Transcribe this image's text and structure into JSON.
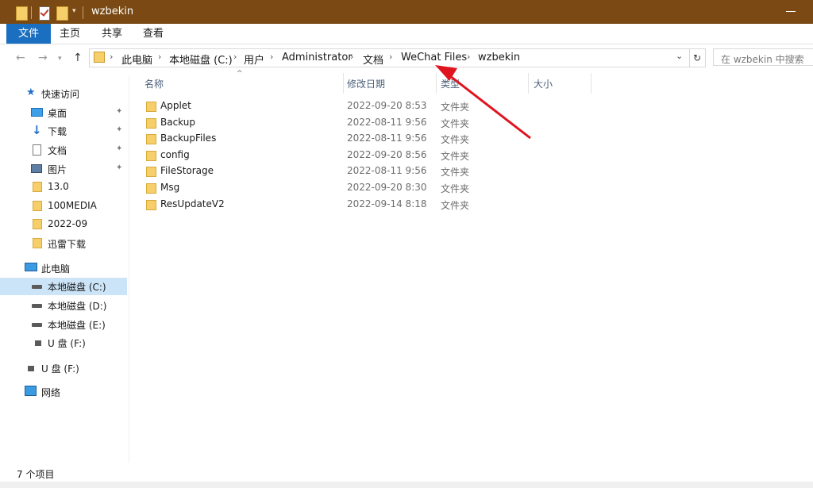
{
  "window": {
    "title": "wzbekin"
  },
  "ribbon": {
    "tabs": [
      "文件",
      "主页",
      "共享",
      "查看"
    ]
  },
  "address": {
    "crumbs": [
      "此电脑",
      "本地磁盘 (C:)",
      "用户",
      "Administrator",
      "文档",
      "WeChat Files",
      "wzbekin"
    ]
  },
  "search": {
    "placeholder": "在 wzbekin 中搜索"
  },
  "sidebar": {
    "quick_access": "快速访问",
    "items": [
      {
        "label": "桌面"
      },
      {
        "label": "下载"
      },
      {
        "label": "文档"
      },
      {
        "label": "图片"
      },
      {
        "label": "13.0"
      },
      {
        "label": "100MEDIA"
      },
      {
        "label": "2022-09"
      },
      {
        "label": "迅雷下载"
      }
    ],
    "this_pc": "此电脑",
    "drives": [
      {
        "label": "本地磁盘 (C:)"
      },
      {
        "label": "本地磁盘 (D:)"
      },
      {
        "label": "本地磁盘 (E:)"
      },
      {
        "label": "U 盘 (F:)"
      }
    ],
    "usb": "U 盘 (F:)",
    "network": "网络"
  },
  "columns": {
    "name": "名称",
    "date": "修改日期",
    "type": "类型",
    "size": "大小"
  },
  "files": [
    {
      "name": "Applet",
      "date": "2022-09-20 8:53",
      "type": "文件夹"
    },
    {
      "name": "Backup",
      "date": "2022-08-11 9:56",
      "type": "文件夹"
    },
    {
      "name": "BackupFiles",
      "date": "2022-08-11 9:56",
      "type": "文件夹"
    },
    {
      "name": "config",
      "date": "2022-09-20 8:56",
      "type": "文件夹"
    },
    {
      "name": "FileStorage",
      "date": "2022-08-11 9:56",
      "type": "文件夹"
    },
    {
      "name": "Msg",
      "date": "2022-09-20 8:30",
      "type": "文件夹"
    },
    {
      "name": "ResUpdateV2",
      "date": "2022-09-14 8:18",
      "type": "文件夹"
    }
  ],
  "status": {
    "count": "7 个项目"
  },
  "colors": {
    "titlebar": "#7b4a14",
    "file_tab": "#1a6fc1",
    "selection": "#cce4f7",
    "annotation_arrow": "#e0141e"
  }
}
